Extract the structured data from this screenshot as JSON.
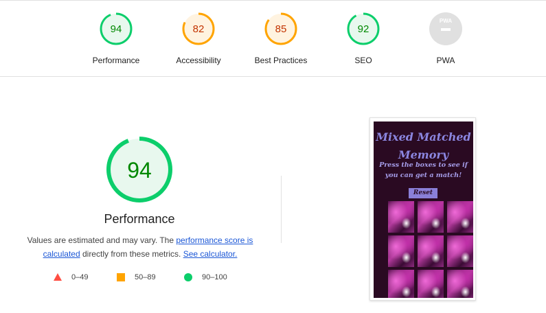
{
  "colors": {
    "pass": "#0cce6b",
    "pass_text": "#008800",
    "pass_bg": "#e8f8ee",
    "average": "#ffa400",
    "average_text": "#c33300",
    "average_bg": "#fff3e0",
    "fail": "#ff4e42",
    "na": "#bdbdbd"
  },
  "categories": [
    {
      "label": "Performance",
      "score": "94",
      "value": 94,
      "status": "pass"
    },
    {
      "label": "Accessibility",
      "score": "82",
      "value": 82,
      "status": "average"
    },
    {
      "label": "Best Practices",
      "score": "85",
      "value": 85,
      "status": "average"
    },
    {
      "label": "SEO",
      "score": "92",
      "value": 92,
      "status": "pass"
    },
    {
      "label": "PWA",
      "score": "",
      "value": null,
      "status": "na",
      "badge_text": "PWA"
    }
  ],
  "main": {
    "score": "94",
    "value": 94,
    "title": "Performance",
    "desc_prefix": "Values are estimated and may vary. The ",
    "desc_link1": "performance score is calculated",
    "desc_middle": " directly from these metrics. ",
    "desc_link2": "See calculator."
  },
  "legend": [
    {
      "shape": "triangle",
      "label": "0–49"
    },
    {
      "shape": "square",
      "label": "50–89"
    },
    {
      "shape": "circle",
      "label": "90–100"
    }
  ],
  "screenshot": {
    "title": "Mixed Matched Memory",
    "subtitle": "Press the boxes to see if you can get a match!",
    "reset_label": "Reset"
  }
}
